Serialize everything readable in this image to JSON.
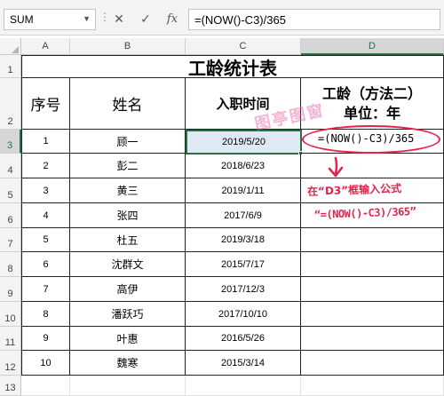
{
  "formula_bar": {
    "name_box": "SUM",
    "cancel_icon": "✕",
    "enter_icon": "✓",
    "fx_label": "fx",
    "formula": "=(NOW()-C3)/365"
  },
  "columns": [
    "A",
    "B",
    "C",
    "D"
  ],
  "rows": [
    "1",
    "2",
    "3",
    "4",
    "5",
    "6",
    "7",
    "8",
    "9",
    "10",
    "11",
    "12",
    "13"
  ],
  "sheet": {
    "title": "工龄统计表",
    "headers": {
      "seq": "序号",
      "name": "姓名",
      "hire_date": "入职时间",
      "tenure_line1": "工龄（方法二）",
      "tenure_line2": "单位：年"
    },
    "records": [
      {
        "seq": "1",
        "name": "顾一",
        "date": "2019/5/20"
      },
      {
        "seq": "2",
        "name": "彭二",
        "date": "2018/6/23"
      },
      {
        "seq": "3",
        "name": "黄三",
        "date": "2019/1/11"
      },
      {
        "seq": "4",
        "name": "张四",
        "date": "2017/6/9"
      },
      {
        "seq": "5",
        "name": "杜五",
        "date": "2019/3/18"
      },
      {
        "seq": "6",
        "name": "沈群文",
        "date": "2015/7/17"
      },
      {
        "seq": "7",
        "name": "高伊",
        "date": "2017/12/3"
      },
      {
        "seq": "8",
        "name": "潘跃巧",
        "date": "2017/10/10"
      },
      {
        "seq": "9",
        "name": "叶惠",
        "date": "2016/5/26"
      },
      {
        "seq": "10",
        "name": "魏寒",
        "date": "2015/3/14"
      }
    ],
    "d3_edit_text": "=(NOW()-C3)/365"
  },
  "annotations": {
    "watermark": "图亭图窗",
    "note_line1": "在“D3”框输入公式",
    "note_line2": "“=(NOW()-C3)/365”",
    "accent_color": "#e8204a"
  },
  "colors": {
    "selection": "#217346",
    "header_bg": "#f3f3f3"
  }
}
